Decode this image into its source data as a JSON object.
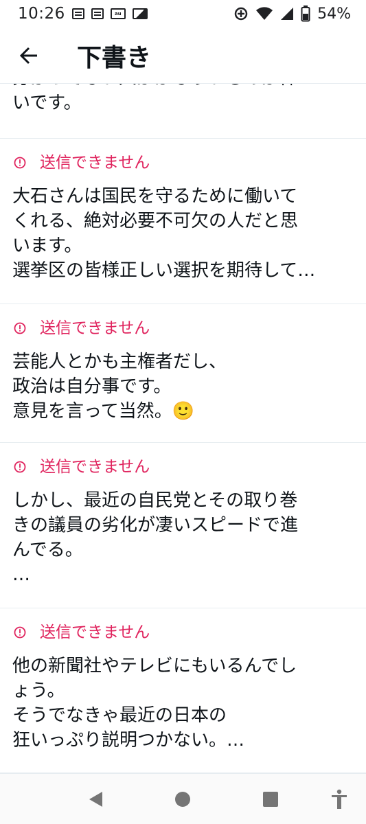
{
  "status_bar": {
    "time": "10:26",
    "au_label": "au",
    "battery_percent": "54%"
  },
  "app_bar": {
    "title": "下書き"
  },
  "drafts": [
    {
      "partial": true,
      "text": "分かってない人がかなりいるのが怖\nいです。"
    },
    {
      "error": "送信できません",
      "text": "大石さんは国民を守るために働いて\nくれる、絶対必要不可欠の人だと思\nいます。\n選挙区の皆様正しい選択を期待して…"
    },
    {
      "error": "送信できません",
      "text": "芸能人とかも主権者だし、\n政治は自分事です。\n意見を言って当然。🙂"
    },
    {
      "error": "送信できません",
      "text": "しかし、最近の自民党とその取り巻\nきの議員の劣化が凄いスピードで進\nんでる。\n…"
    },
    {
      "error": "送信できません",
      "text": "他の新聞社やテレビにもいるんでし\nょう。\nそうでなきゃ最近の日本の\n狂いっぷり説明つかない。…"
    }
  ],
  "colors": {
    "error": "#e0245e",
    "text": "#0f1419",
    "divider": "#e6ecf0"
  },
  "nav_icons": [
    "back-triangle-icon",
    "home-circle-icon",
    "recents-square-icon",
    "accessibility-icon"
  ]
}
